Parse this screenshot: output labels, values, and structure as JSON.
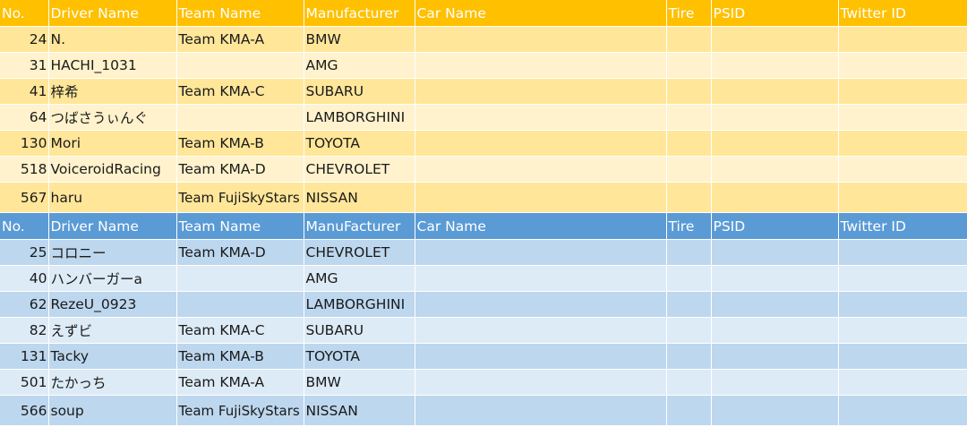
{
  "group_a": {
    "header": [
      "No.",
      "Driver Name",
      "Team Name",
      "Manufacturer",
      "Car Name",
      "Tire",
      "PSID",
      "Twitter ID"
    ],
    "rows": [
      {
        "no": "24",
        "driver": "N.",
        "team": "Team KMA-A",
        "manufacturer": "BMW",
        "car": "",
        "tire": "",
        "psid": "",
        "twitter": ""
      },
      {
        "no": "31",
        "driver": "HACHI_1031",
        "team": "",
        "manufacturer": "AMG",
        "car": "",
        "tire": "",
        "psid": "",
        "twitter": ""
      },
      {
        "no": "41",
        "driver": "梓希",
        "team": "Team KMA-C",
        "manufacturer": "SUBARU",
        "car": "",
        "tire": "",
        "psid": "",
        "twitter": ""
      },
      {
        "no": "64",
        "driver": "つばさうぃんぐ",
        "team": "",
        "manufacturer": "LAMBORGHINI",
        "car": "",
        "tire": "",
        "psid": "",
        "twitter": ""
      },
      {
        "no": "130",
        "driver": "Mori",
        "team": "Team KMA-B",
        "manufacturer": "TOYOTA",
        "car": "",
        "tire": "",
        "psid": "",
        "twitter": ""
      },
      {
        "no": "518",
        "driver": "VoiceroidRacing",
        "team": "Team KMA-D",
        "manufacturer": "CHEVROLET",
        "car": "",
        "tire": "",
        "psid": "",
        "twitter": ""
      },
      {
        "no": "567",
        "driver": "haru",
        "team": "Team FujiSkyStars",
        "manufacturer": "NISSAN",
        "car": "",
        "tire": "",
        "psid": "",
        "twitter": ""
      }
    ]
  },
  "group_b": {
    "header": [
      "No.",
      "Driver Name",
      "Team Name",
      "ManuFacturer",
      "Car Name",
      "Tire",
      "PSID",
      "Twitter ID"
    ],
    "rows": [
      {
        "no": "25",
        "driver": "コロニー",
        "team": "Team KMA-D",
        "manufacturer": "CHEVROLET",
        "car": "",
        "tire": "",
        "psid": "",
        "twitter": ""
      },
      {
        "no": "40",
        "driver": "ハンバーガーa",
        "team": "",
        "manufacturer": "AMG",
        "car": "",
        "tire": "",
        "psid": "",
        "twitter": ""
      },
      {
        "no": "62",
        "driver": "RezeU_0923",
        "team": "",
        "manufacturer": "LAMBORGHINI",
        "car": "",
        "tire": "",
        "psid": "",
        "twitter": ""
      },
      {
        "no": "82",
        "driver": "えずビ",
        "team": "Team KMA-C",
        "manufacturer": "SUBARU",
        "car": "",
        "tire": "",
        "psid": "",
        "twitter": ""
      },
      {
        "no": "131",
        "driver": "Tacky",
        "team": "Team KMA-B",
        "manufacturer": "TOYOTA",
        "car": "",
        "tire": "",
        "psid": "",
        "twitter": ""
      },
      {
        "no": "501",
        "driver": "たかっち",
        "team": "Team KMA-A",
        "manufacturer": "BMW",
        "car": "",
        "tire": "",
        "psid": "",
        "twitter": ""
      },
      {
        "no": "566",
        "driver": "soup",
        "team": "Team FujiSkyStars",
        "manufacturer": "NISSAN",
        "car": "",
        "tire": "",
        "psid": "",
        "twitter": ""
      }
    ]
  },
  "colors": {
    "group_a_header": "#ffc000",
    "group_a_band_1": "#ffe699",
    "group_a_band_2": "#fff2cc",
    "group_b_header": "#5b9bd5",
    "group_b_band_1": "#bdd7ee",
    "group_b_band_2": "#ddebf7"
  }
}
